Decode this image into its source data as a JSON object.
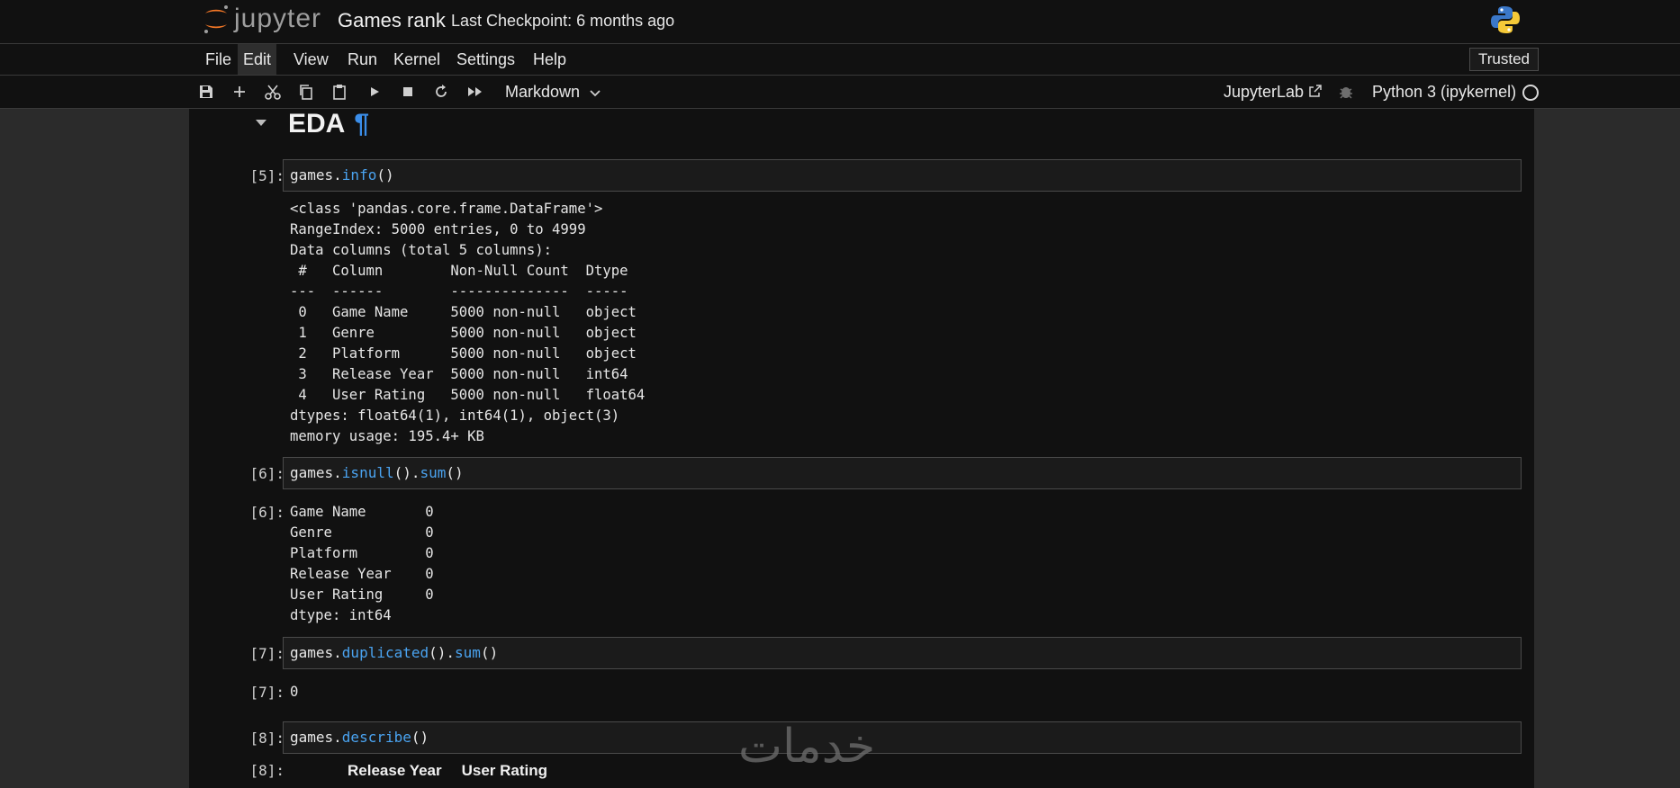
{
  "app": {
    "logo_text": "jupyter",
    "notebook_title": "Games rank",
    "checkpoint": "Last Checkpoint: 6 months ago"
  },
  "menu": {
    "items": [
      "File",
      "Edit",
      "View",
      "Run",
      "Kernel",
      "Settings",
      "Help"
    ],
    "trusted": "Trusted"
  },
  "toolbar": {
    "cell_type": "Markdown",
    "jupyterlab_label": "JupyterLab",
    "kernel": "Python 3 (ipykernel)"
  },
  "notebook": {
    "heading": "EDA",
    "anchor": "¶",
    "cells": [
      {
        "in_prompt": "[5]:",
        "code": {
          "obj": "games.",
          "fn": "info",
          "tail": "()"
        },
        "output": "<class 'pandas.core.frame.DataFrame'>\nRangeIndex: 5000 entries, 0 to 4999\nData columns (total 5 columns):\n #   Column        Non-Null Count  Dtype  \n---  ------        --------------  -----  \n 0   Game Name     5000 non-null   object \n 1   Genre         5000 non-null   object \n 2   Platform      5000 non-null   object \n 3   Release Year  5000 non-null   int64  \n 4   User Rating   5000 non-null   float64\ndtypes: float64(1), int64(1), object(3)\nmemory usage: 195.4+ KB"
      },
      {
        "in_prompt": "[6]:",
        "code": {
          "obj": "games.",
          "fn": "isnull",
          "mid": "().",
          "fn2": "sum",
          "tail": "()"
        },
        "out_prompt": "[6]:",
        "output": "Game Name       0\nGenre           0\nPlatform        0\nRelease Year    0\nUser Rating     0\ndtype: int64"
      },
      {
        "in_prompt": "[7]:",
        "code": {
          "obj": "games.",
          "fn": "duplicated",
          "mid": "().",
          "fn2": "sum",
          "tail": "()"
        },
        "out_prompt": "[7]:",
        "output": "0"
      },
      {
        "in_prompt": "[8]:",
        "code": {
          "obj": "games.",
          "fn": "describe",
          "tail": "()"
        },
        "out_prompt": "[8]:",
        "table_headers": [
          "Release Year",
          "User Rating"
        ]
      }
    ]
  },
  "watermark": "خدمات",
  "colors": {
    "background": "#111111",
    "accent": "#4aa3f0",
    "logo_orange": "#f37726"
  },
  "icons": [
    "save-icon",
    "add-icon",
    "cut-icon",
    "copy-icon",
    "paste-icon",
    "run-icon",
    "stop-icon",
    "restart-icon",
    "fast-forward-icon",
    "external-link-icon",
    "bug-icon"
  ]
}
